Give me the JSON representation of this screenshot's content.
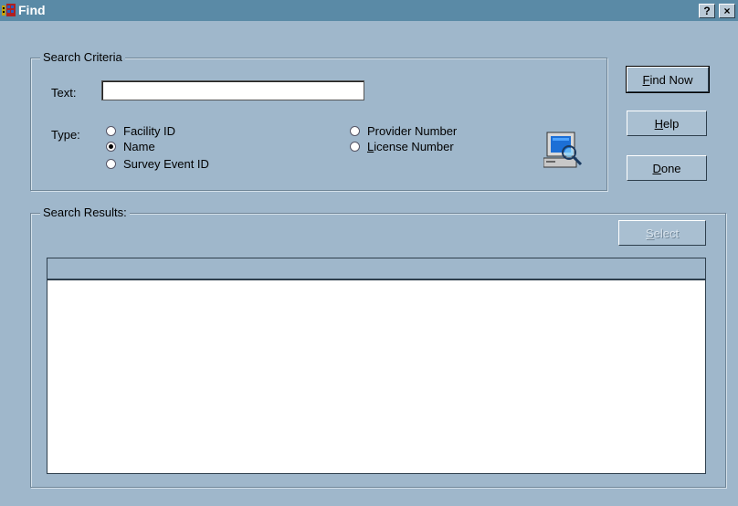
{
  "window": {
    "title": "Find",
    "help_glyph": "?",
    "close_glyph": "×"
  },
  "criteria": {
    "legend": "Search Criteria",
    "text_label": "Text:",
    "text_value": "",
    "type_label": "Type:",
    "options": [
      {
        "label": "Facility ID",
        "checked": false
      },
      {
        "label": "Name",
        "checked": true
      },
      {
        "label": "Survey Event ID",
        "checked": false
      },
      {
        "label": "Provider Number",
        "checked": false
      },
      {
        "label": "License Number",
        "checked": false
      }
    ],
    "icon": "search-computer-icon"
  },
  "buttons": {
    "find_now": "Find Now",
    "help": "Help",
    "done": "Done",
    "select": "Select"
  },
  "results": {
    "legend": "Search Results:",
    "rows": []
  }
}
